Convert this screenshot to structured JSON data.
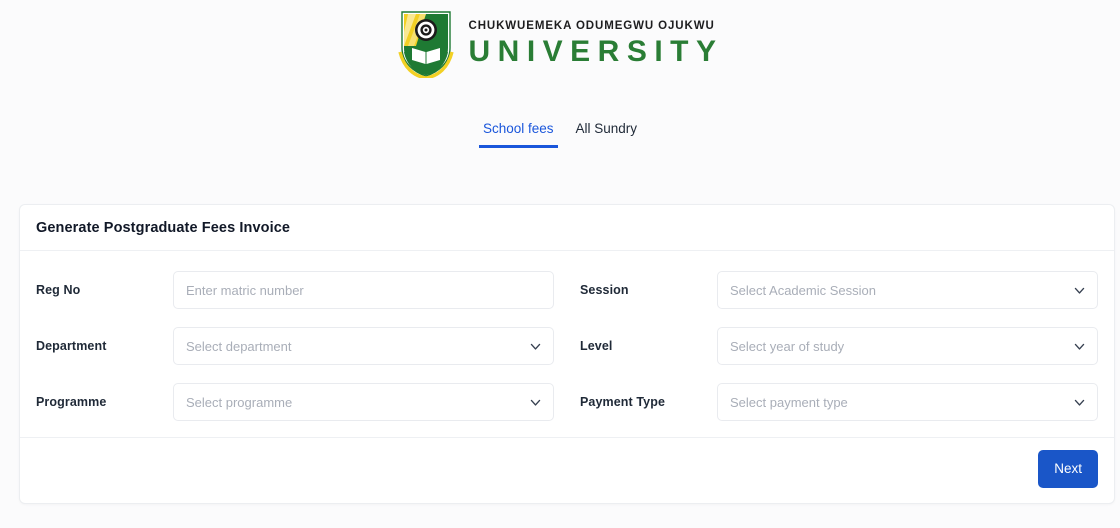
{
  "brand": {
    "logo_icon": "university-crest-icon",
    "name_line1": "CHUKWUEMEKA ODUMEGWU OJUKWU",
    "name_line2": "UNIVERSITY",
    "colors": {
      "name_line1": "#1d1d1f",
      "name_line2": "#2a7d35",
      "crest_yellow": "#f2d024",
      "crest_green": "#1e7a33"
    }
  },
  "tabs": {
    "items": [
      {
        "label": "School fees",
        "active": true
      },
      {
        "label": "All Sundry",
        "active": false
      }
    ],
    "active_color": "#1a56db"
  },
  "card": {
    "title": "Generate Postgraduate Fees Invoice",
    "fields": [
      {
        "label": "Reg No",
        "type": "text",
        "placeholder": "Enter matric number",
        "value": "",
        "icon": ""
      },
      {
        "label": "Session",
        "type": "select",
        "placeholder": "Select Academic Session",
        "value": "",
        "icon": "chevron-down-icon"
      },
      {
        "label": "Department",
        "type": "select",
        "placeholder": "Select department",
        "value": "",
        "icon": "chevron-down-icon"
      },
      {
        "label": "Level",
        "type": "select",
        "placeholder": "Select year of study",
        "value": "",
        "icon": "chevron-down-icon"
      },
      {
        "label": "Programme",
        "type": "select",
        "placeholder": "Select programme",
        "value": "",
        "icon": "chevron-down-icon"
      },
      {
        "label": "Payment Type",
        "type": "select",
        "placeholder": "Select payment type",
        "value": "",
        "icon": "chevron-down-icon"
      }
    ],
    "footer": {
      "next_label": "Next",
      "next_color": "#1a56c8"
    }
  }
}
